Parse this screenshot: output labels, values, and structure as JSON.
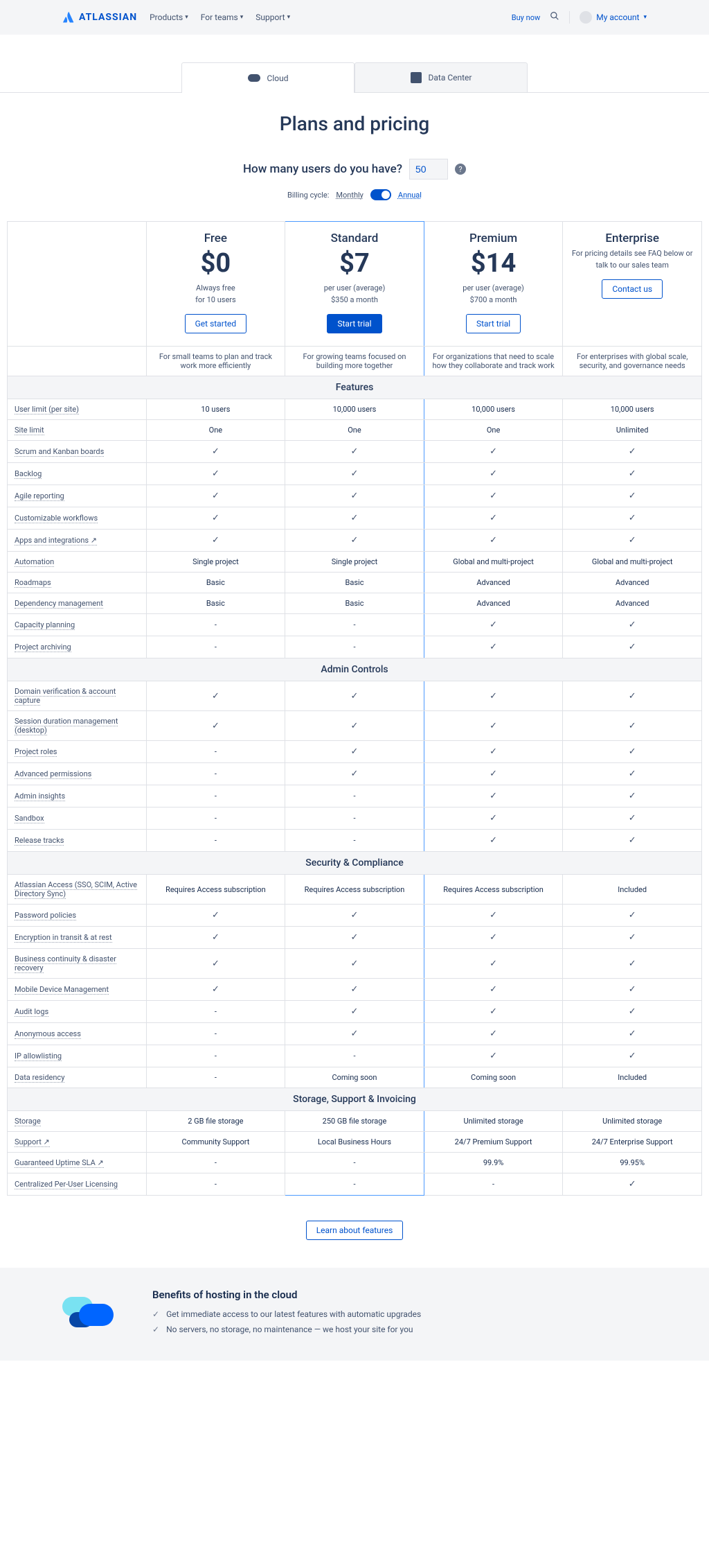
{
  "nav": {
    "brand": "ATLASSIAN",
    "items": [
      "Products",
      "For teams",
      "Support"
    ],
    "buy": "Buy now",
    "account": "My account"
  },
  "tabs": {
    "cloud": "Cloud",
    "dc": "Data Center"
  },
  "title": "Plans and pricing",
  "userQ": {
    "label": "How many users do you have?",
    "value": "50"
  },
  "billing": {
    "label": "Billing cycle:",
    "monthly": "Monthly",
    "annual": "Annual"
  },
  "plans": [
    {
      "name": "Free",
      "price": "$0",
      "sub1": "Always free",
      "sub2": "for 10 users",
      "cta": "Get started",
      "ctaStyle": "outline",
      "desc": "For small teams to plan and track work more efficiently"
    },
    {
      "name": "Standard",
      "price": "$7",
      "sub1": "per user (average)",
      "sub2": "$350 a month",
      "cta": "Start trial",
      "ctaStyle": "fill",
      "desc": "For growing teams focused on building more together"
    },
    {
      "name": "Premium",
      "price": "$14",
      "sub1": "per user (average)",
      "sub2": "$700 a month",
      "cta": "Start trial",
      "ctaStyle": "outline",
      "desc": "For organizations that need to scale how they collaborate and track work"
    },
    {
      "name": "Enterprise",
      "price": "",
      "sub1": "For pricing details see FAQ below or talk to our sales team",
      "sub2": "",
      "cta": "Contact us",
      "ctaStyle": "outline",
      "desc": "For enterprises with global scale, security, and governance needs"
    }
  ],
  "sections": [
    {
      "title": "Features",
      "rows": [
        {
          "f": "User limit (per site)",
          "v": [
            "10 users",
            "10,000 users",
            "10,000 users",
            "10,000 users"
          ]
        },
        {
          "f": "Site limit",
          "v": [
            "One",
            "One",
            "One",
            "Unlimited"
          ]
        },
        {
          "f": "Scrum and Kanban boards",
          "v": [
            "✓",
            "✓",
            "✓",
            "✓"
          ]
        },
        {
          "f": "Backlog",
          "v": [
            "✓",
            "✓",
            "✓",
            "✓"
          ]
        },
        {
          "f": "Agile reporting",
          "v": [
            "✓",
            "✓",
            "✓",
            "✓"
          ]
        },
        {
          "f": "Customizable workflows",
          "v": [
            "✓",
            "✓",
            "✓",
            "✓"
          ]
        },
        {
          "f": "Apps and integrations ↗",
          "v": [
            "✓",
            "✓",
            "✓",
            "✓"
          ]
        },
        {
          "f": "Automation",
          "v": [
            "Single project",
            "Single project",
            "Global and multi-project",
            "Global and multi-project"
          ]
        },
        {
          "f": "Roadmaps",
          "v": [
            "Basic",
            "Basic",
            "Advanced",
            "Advanced"
          ]
        },
        {
          "f": "Dependency management",
          "v": [
            "Basic",
            "Basic",
            "Advanced",
            "Advanced"
          ]
        },
        {
          "f": "Capacity planning",
          "v": [
            "-",
            "-",
            "✓",
            "✓"
          ]
        },
        {
          "f": "Project archiving",
          "v": [
            "-",
            "-",
            "✓",
            "✓"
          ]
        }
      ]
    },
    {
      "title": "Admin Controls",
      "rows": [
        {
          "f": "Domain verification & account capture",
          "v": [
            "✓",
            "✓",
            "✓",
            "✓"
          ]
        },
        {
          "f": "Session duration management (desktop)",
          "v": [
            "✓",
            "✓",
            "✓",
            "✓"
          ]
        },
        {
          "f": "Project roles",
          "v": [
            "-",
            "✓",
            "✓",
            "✓"
          ]
        },
        {
          "f": "Advanced permissions",
          "v": [
            "-",
            "✓",
            "✓",
            "✓"
          ]
        },
        {
          "f": "Admin insights",
          "v": [
            "-",
            "-",
            "✓",
            "✓"
          ]
        },
        {
          "f": "Sandbox",
          "v": [
            "-",
            "-",
            "✓",
            "✓"
          ]
        },
        {
          "f": "Release tracks",
          "v": [
            "-",
            "-",
            "✓",
            "✓"
          ]
        }
      ]
    },
    {
      "title": "Security & Compliance",
      "rows": [
        {
          "f": "Atlassian Access (SSO, SCIM, Active Directory Sync)",
          "v": [
            "Requires Access subscription",
            "Requires Access subscription",
            "Requires Access subscription",
            "Included"
          ]
        },
        {
          "f": "Password policies",
          "v": [
            "✓",
            "✓",
            "✓",
            "✓"
          ]
        },
        {
          "f": "Encryption in transit & at rest",
          "v": [
            "✓",
            "✓",
            "✓",
            "✓"
          ]
        },
        {
          "f": "Business continuity & disaster recovery",
          "v": [
            "✓",
            "✓",
            "✓",
            "✓"
          ]
        },
        {
          "f": "Mobile Device Management",
          "v": [
            "✓",
            "✓",
            "✓",
            "✓"
          ]
        },
        {
          "f": "Audit logs",
          "v": [
            "-",
            "✓",
            "✓",
            "✓"
          ]
        },
        {
          "f": "Anonymous access",
          "v": [
            "-",
            "✓",
            "✓",
            "✓"
          ]
        },
        {
          "f": "IP allowlisting",
          "v": [
            "-",
            "-",
            "✓",
            "✓"
          ]
        },
        {
          "f": "Data residency",
          "v": [
            "-",
            "Coming soon",
            "Coming soon",
            "Included"
          ]
        }
      ]
    },
    {
      "title": "Storage, Support & Invoicing",
      "rows": [
        {
          "f": "Storage",
          "v": [
            "2 GB file storage",
            "250 GB file storage",
            "Unlimited storage",
            "Unlimited storage"
          ]
        },
        {
          "f": "Support ↗",
          "v": [
            "Community Support",
            "Local Business Hours",
            "24/7 Premium Support",
            "24/7 Enterprise Support"
          ]
        },
        {
          "f": "Guaranteed Uptime SLA ↗",
          "v": [
            "-",
            "-",
            "99.9%",
            "99.95%"
          ]
        },
        {
          "f": "Centralized Per-User Licensing",
          "v": [
            "-",
            "-",
            "-",
            "✓"
          ]
        }
      ]
    }
  ],
  "learn": "Learn about features",
  "benefits": {
    "title": "Benefits of hosting in the cloud",
    "items": [
      "Get immediate access to our latest features with automatic upgrades",
      "No servers, no storage, no maintenance — we host your site for you"
    ]
  }
}
